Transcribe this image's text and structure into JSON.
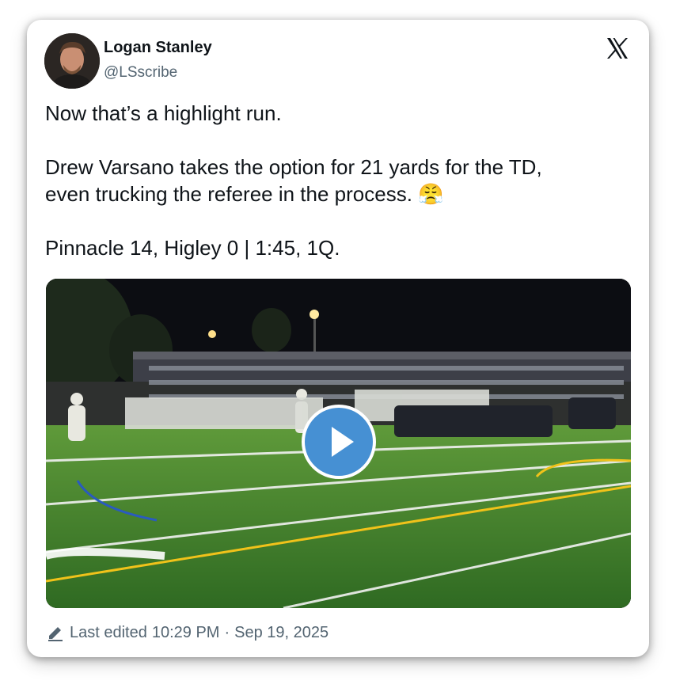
{
  "author": {
    "name": "Logan Stanley",
    "handle": "@LSscribe"
  },
  "tweet": {
    "line1": "Now that’s a highlight run.",
    "line2": "Drew Varsano takes the option for 21 yards for the TD,",
    "line3": "even trucking the referee in the process.",
    "emoji": "😤",
    "line4": "Pinnacle 14, Higley 0 | 1:45, 1Q."
  },
  "footer": {
    "edited_label": "Last edited",
    "time": "10:29 PM",
    "separator": "·",
    "date": "Sep 19, 2025"
  },
  "icons": {
    "brand": "x-logo-icon",
    "edit": "pencil-icon",
    "play": "play-icon"
  },
  "colors": {
    "text": "#0f1419",
    "secondary": "#536471",
    "play_button": "#4690d3",
    "turf": "#3f7d2a"
  }
}
